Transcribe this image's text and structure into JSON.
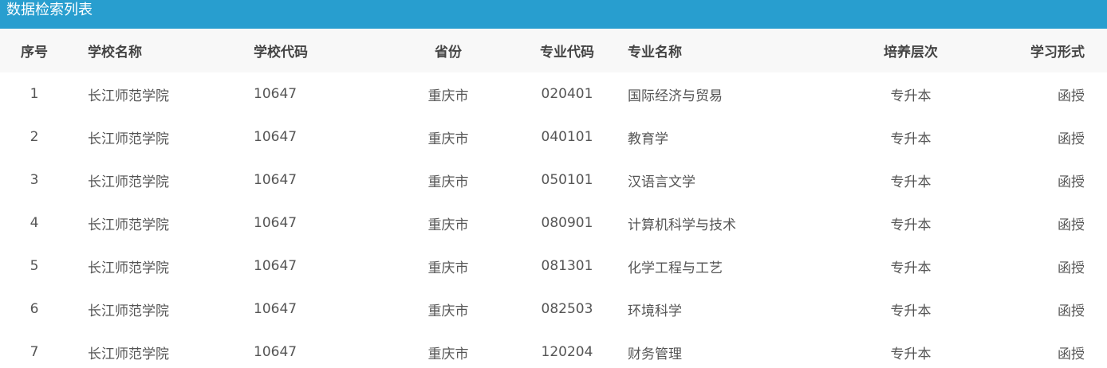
{
  "panel": {
    "title": "数据检索列表"
  },
  "table": {
    "headers": [
      "序号",
      "学校名称",
      "学校代码",
      "省份",
      "专业代码",
      "专业名称",
      "培养层次",
      "学习形式"
    ],
    "rows": [
      [
        "1",
        "长江师范学院",
        "10647",
        "重庆市",
        "020401",
        "国际经济与贸易",
        "专升本",
        "函授"
      ],
      [
        "2",
        "长江师范学院",
        "10647",
        "重庆市",
        "040101",
        "教育学",
        "专升本",
        "函授"
      ],
      [
        "3",
        "长江师范学院",
        "10647",
        "重庆市",
        "050101",
        "汉语言文学",
        "专升本",
        "函授"
      ],
      [
        "4",
        "长江师范学院",
        "10647",
        "重庆市",
        "080901",
        "计算机科学与技术",
        "专升本",
        "函授"
      ],
      [
        "5",
        "长江师范学院",
        "10647",
        "重庆市",
        "081301",
        "化学工程与工艺",
        "专升本",
        "函授"
      ],
      [
        "6",
        "长江师范学院",
        "10647",
        "重庆市",
        "082503",
        "环境科学",
        "专升本",
        "函授"
      ],
      [
        "7",
        "长江师范学院",
        "10647",
        "重庆市",
        "120204",
        "财务管理",
        "专升本",
        "函授"
      ]
    ]
  },
  "colors": {
    "header_bar": "#289ecf",
    "table_head_bg": "#f8f8f8"
  }
}
